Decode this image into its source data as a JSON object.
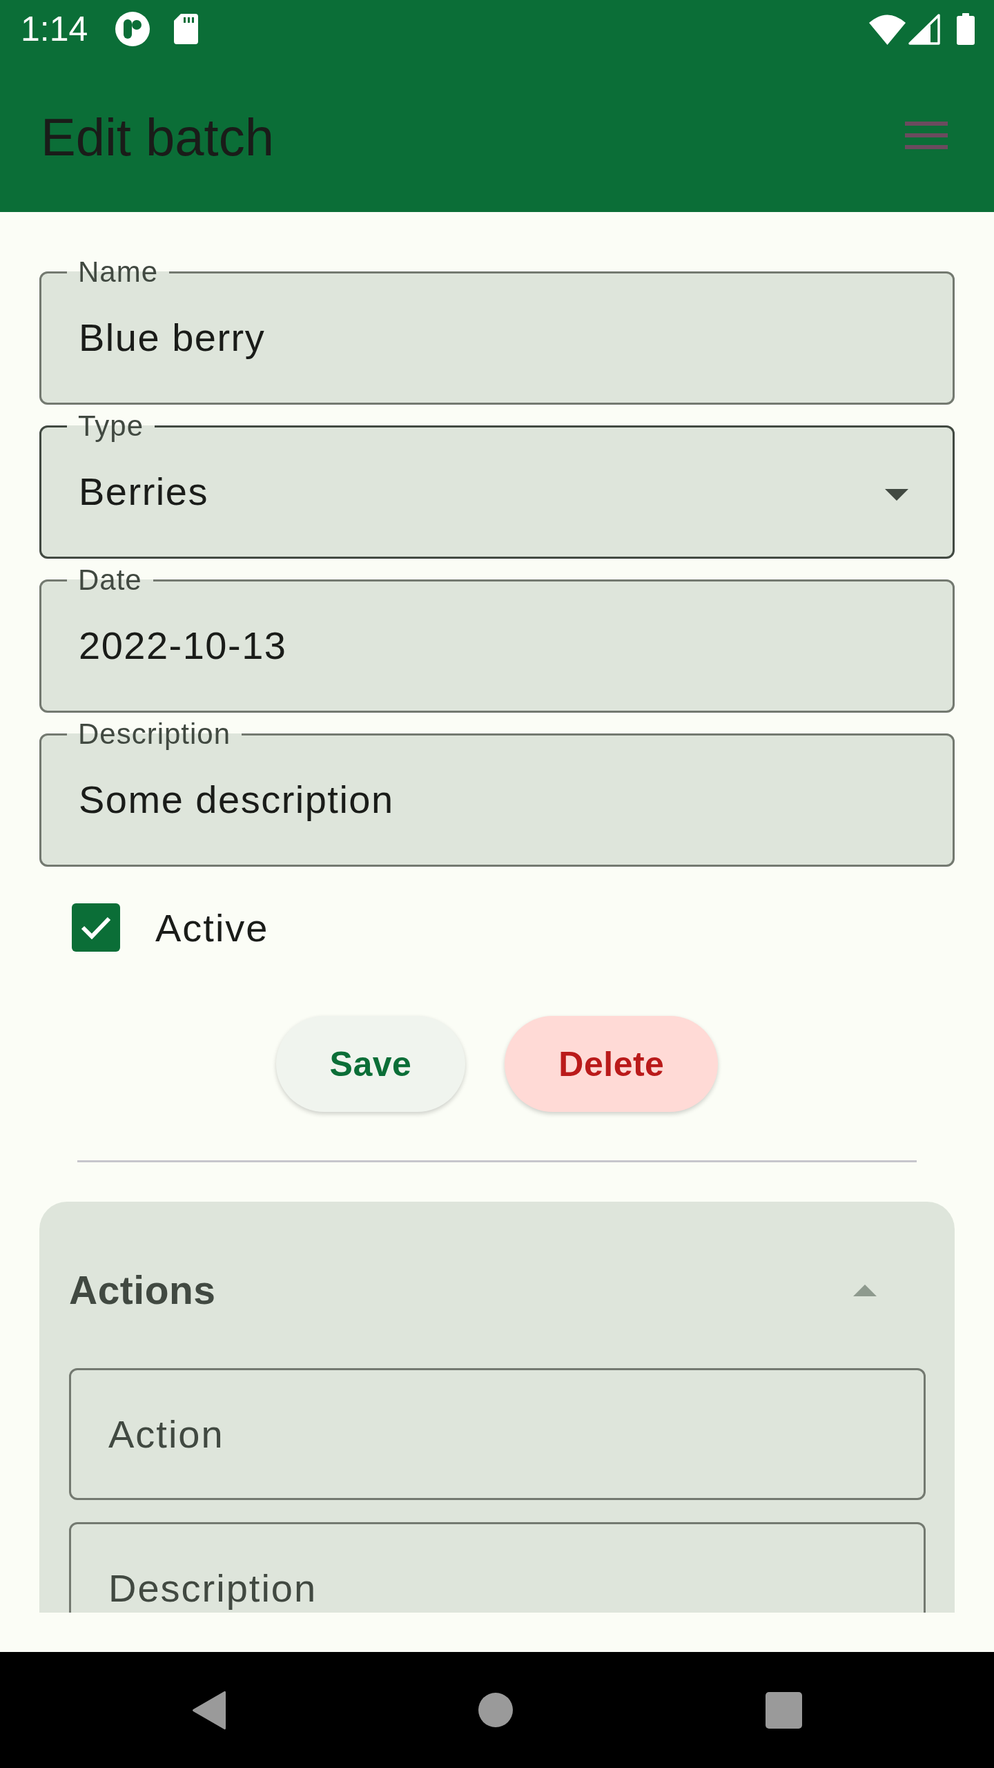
{
  "status_bar": {
    "time": "1:14"
  },
  "app_bar": {
    "title": "Edit batch"
  },
  "form": {
    "fields": [
      {
        "kind": "text",
        "label": "Name",
        "value": "Blue berry"
      },
      {
        "kind": "dropdown",
        "label": "Type",
        "value": "Berries"
      },
      {
        "kind": "text",
        "label": "Date",
        "value": "2022-10-13"
      },
      {
        "kind": "text",
        "label": "Description",
        "value": "Some description"
      }
    ],
    "checkbox": {
      "label": "Active",
      "checked": true
    },
    "buttons": [
      {
        "kind": "elevated",
        "label": "Save"
      },
      {
        "kind": "danger",
        "label": "Delete"
      }
    ]
  },
  "actions_panel": {
    "title": "Actions",
    "expanded": true,
    "fields": [
      {
        "placeholder": "Action"
      },
      {
        "placeholder": "Description"
      }
    ]
  }
}
